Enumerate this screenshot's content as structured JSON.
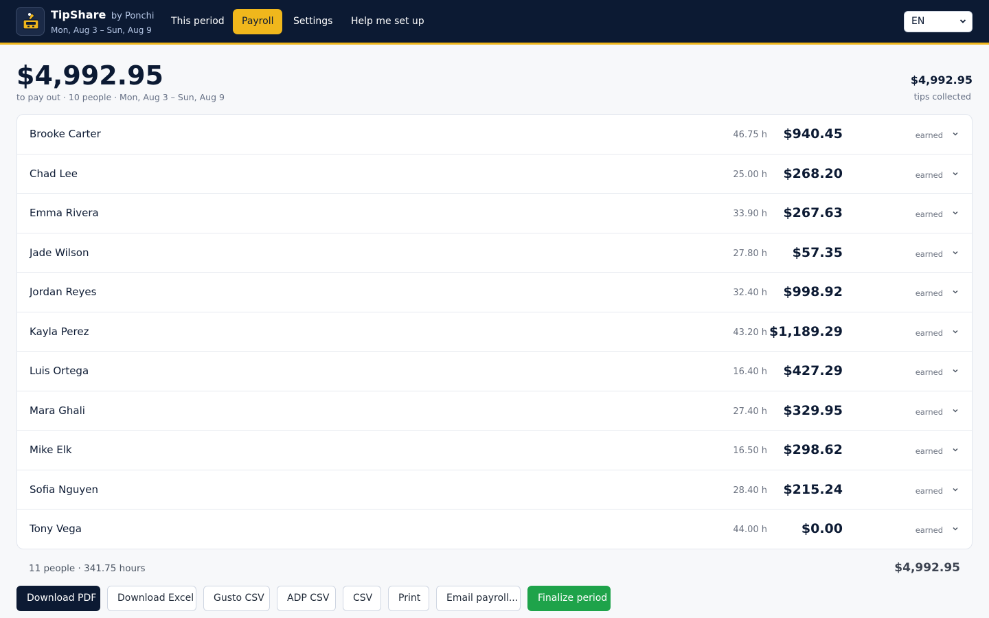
{
  "header": {
    "brand_name": "TipShare",
    "brand_by": "by Ponchi",
    "period": "Mon, Aug 3 – Sun, Aug 9",
    "nav": [
      {
        "label": "This period",
        "active": false
      },
      {
        "label": "Payroll",
        "active": true
      },
      {
        "label": "Settings",
        "active": false
      },
      {
        "label": "Help me set up",
        "active": false
      }
    ],
    "language": "EN"
  },
  "summary": {
    "total": "$4,992.95",
    "subtitle": "to pay out · 10 people · Mon, Aug 3 – Sun, Aug 9",
    "collected_amount": "$4,992.95",
    "collected_label": "tips collected"
  },
  "rows": [
    {
      "name": "Brooke Carter",
      "hours": "46.75 h",
      "amount": "$940.45",
      "status": "earned"
    },
    {
      "name": "Chad Lee",
      "hours": "25.00 h",
      "amount": "$268.20",
      "status": "earned"
    },
    {
      "name": "Emma Rivera",
      "hours": "33.90 h",
      "amount": "$267.63",
      "status": "earned"
    },
    {
      "name": "Jade Wilson",
      "hours": "27.80 h",
      "amount": "$57.35",
      "status": "earned"
    },
    {
      "name": "Jordan Reyes",
      "hours": "32.40 h",
      "amount": "$998.92",
      "status": "earned"
    },
    {
      "name": "Kayla Perez",
      "hours": "43.20 h",
      "amount": "$1,189.29",
      "status": "earned"
    },
    {
      "name": "Luis Ortega",
      "hours": "16.40 h",
      "amount": "$427.29",
      "status": "earned"
    },
    {
      "name": "Mara Ghali",
      "hours": "27.40 h",
      "amount": "$329.95",
      "status": "earned"
    },
    {
      "name": "Mike Elk",
      "hours": "16.50 h",
      "amount": "$298.62",
      "status": "earned"
    },
    {
      "name": "Sofia Nguyen",
      "hours": "28.40 h",
      "amount": "$215.24",
      "status": "earned"
    },
    {
      "name": "Tony Vega",
      "hours": "44.00 h",
      "amount": "$0.00",
      "status": "earned"
    }
  ],
  "footer": {
    "count": "11 people · 341.75 hours",
    "total": "$4,992.95"
  },
  "actions": {
    "download_pdf": "Download PDF",
    "download_excel": "Download Excel",
    "gusto_csv": "Gusto CSV",
    "adp_csv": "ADP CSV",
    "csv": "CSV",
    "print": "Print",
    "email_payroll": "Email payroll...",
    "finalize": "Finalize period"
  },
  "colors": {
    "navy": "#0c1a33",
    "accent_yellow": "#f0b71c",
    "finalize_green": "#1ea34a"
  }
}
